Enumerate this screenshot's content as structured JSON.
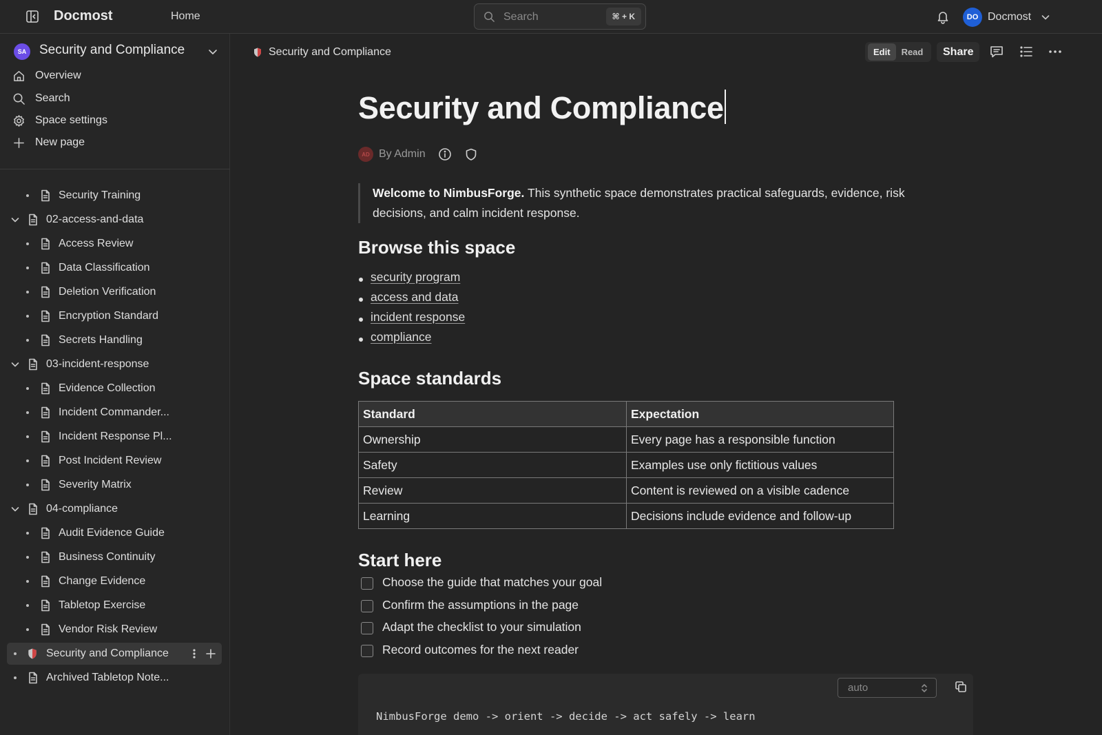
{
  "topbar": {
    "brand": "Docmost",
    "home": "Home",
    "search_placeholder": "Search",
    "search_shortcut": "⌘ + K",
    "user_initials": "DO",
    "user_name": "Docmost"
  },
  "sidebar": {
    "space_initials": "SA",
    "space_name": "Security and Compliance",
    "nav": [
      {
        "label": "Overview",
        "icon": "home-icon"
      },
      {
        "label": "Search",
        "icon": "search-icon"
      },
      {
        "label": "Space settings",
        "icon": "gear-icon"
      },
      {
        "label": "New page",
        "icon": "plus-icon"
      }
    ],
    "tree": [
      {
        "label": "Security Training",
        "level": 2
      },
      {
        "label": "02-access-and-data",
        "level": 1,
        "expanded": true
      },
      {
        "label": "Access Review",
        "level": 2
      },
      {
        "label": "Data Classification",
        "level": 2
      },
      {
        "label": "Deletion Verification",
        "level": 2
      },
      {
        "label": "Encryption Standard",
        "level": 2
      },
      {
        "label": "Secrets Handling",
        "level": 2
      },
      {
        "label": "03-incident-response",
        "level": 1,
        "expanded": true
      },
      {
        "label": "Evidence Collection",
        "level": 2
      },
      {
        "label": "Incident Commander...",
        "level": 2
      },
      {
        "label": "Incident Response Pl...",
        "level": 2
      },
      {
        "label": "Post Incident Review",
        "level": 2
      },
      {
        "label": "Severity Matrix",
        "level": 2
      },
      {
        "label": "04-compliance",
        "level": 1,
        "expanded": true
      },
      {
        "label": "Audit Evidence Guide",
        "level": 2
      },
      {
        "label": "Business Continuity",
        "level": 2
      },
      {
        "label": "Change Evidence",
        "level": 2
      },
      {
        "label": "Tabletop Exercise",
        "level": 2
      },
      {
        "label": "Vendor Risk Review",
        "level": 2
      },
      {
        "label": "Security and Compliance",
        "level": 0,
        "active": true,
        "icon": "shield-emoji-icon"
      },
      {
        "label": "Archived Tabletop Note...",
        "level": 0
      }
    ]
  },
  "header": {
    "breadcrumb": "Security and Compliance",
    "mode_edit": "Edit",
    "mode_read": "Read",
    "active_mode": "Edit",
    "share": "Share"
  },
  "page": {
    "title": "Security and Compliance",
    "author_initials": "AD",
    "byline": "By Admin",
    "intro_bold": "Welcome to NimbusForge.",
    "intro_text": " This synthetic space demonstrates practical safeguards, evidence, risk decisions, and calm incident response.",
    "browse_heading": "Browse this space",
    "links": [
      "security program",
      "access and data",
      "incident response",
      "compliance"
    ],
    "standards_heading": "Space standards",
    "table": {
      "headers": [
        "Standard",
        "Expectation"
      ],
      "rows": [
        [
          "Ownership",
          "Every page has a responsible function"
        ],
        [
          "Safety",
          "Examples use only fictitious values"
        ],
        [
          "Review",
          "Content is reviewed on a visible cadence"
        ],
        [
          "Learning",
          "Decisions include evidence and follow-up"
        ]
      ]
    },
    "start_heading": "Start here",
    "checklist": [
      {
        "label": "Choose the guide that matches your goal",
        "checked": false
      },
      {
        "label": "Confirm the assumptions in the page",
        "checked": false
      },
      {
        "label": "Adapt the checklist to your simulation",
        "checked": false
      },
      {
        "label": "Record outcomes for the next reader",
        "checked": false
      }
    ],
    "code": {
      "language": "auto",
      "text": "NimbusForge demo -> orient -> decide -> act safely -> learn"
    }
  }
}
